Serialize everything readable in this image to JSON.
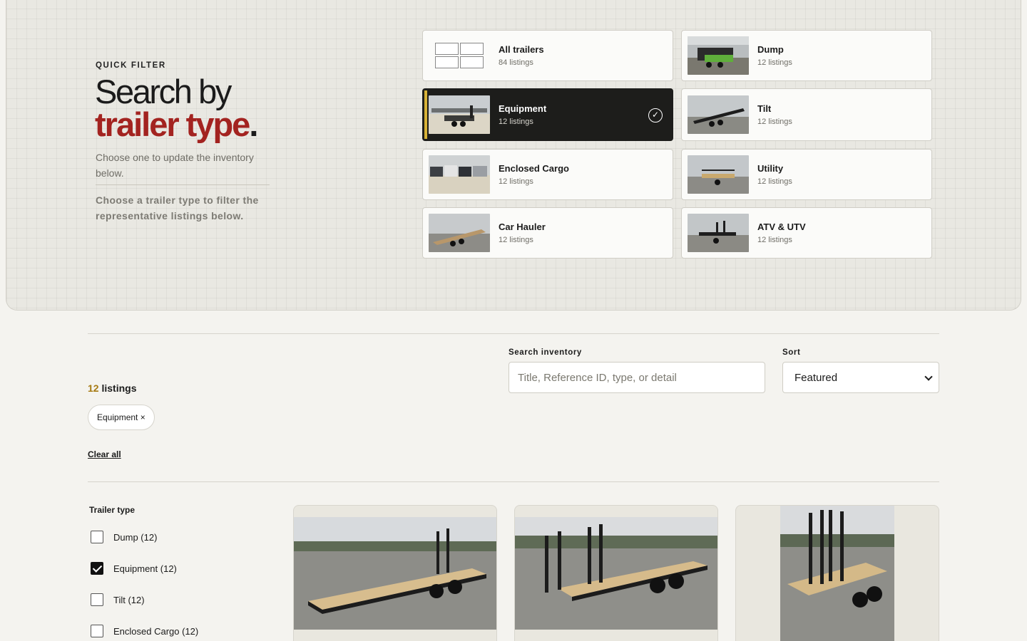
{
  "hero": {
    "eyebrow": "QUICK FILTER",
    "headline_plain": "Search by",
    "headline_accent": "trailer type",
    "headline_dot": ".",
    "description": "Choose one to update the inventory below.",
    "note": "Choose a trailer type to filter the representative listings below."
  },
  "trailer_types": [
    {
      "title": "All trailers",
      "count": "84 listings"
    },
    {
      "title": "Dump",
      "count": "12 listings"
    },
    {
      "title": "Equipment",
      "count": "12 listings",
      "selected": true
    },
    {
      "title": "Tilt",
      "count": "12 listings"
    },
    {
      "title": "Enclosed Cargo",
      "count": "12 listings"
    },
    {
      "title": "Utility",
      "count": "12 listings"
    },
    {
      "title": "Car Hauler",
      "count": "12 listings"
    },
    {
      "title": "ATV & UTV",
      "count": "12 listings"
    }
  ],
  "toolbar": {
    "count_number": "12",
    "count_label": "listings",
    "active_chip": "Equipment ×",
    "clear_all": "Clear all",
    "search_label": "Search inventory",
    "search_placeholder": "Title, Reference ID, type, or detail",
    "sort_label": "Sort",
    "sort_value": "Featured"
  },
  "filters": {
    "heading": "Trailer type",
    "items": [
      {
        "label": "Dump (12)",
        "checked": false
      },
      {
        "label": "Equipment (12)",
        "checked": true
      },
      {
        "label": "Tilt (12)",
        "checked": false
      },
      {
        "label": "Enclosed Cargo (12)",
        "checked": false
      }
    ]
  },
  "colors": {
    "accent_red": "#a32320",
    "accent_gold": "#d8b237",
    "count_gold": "#a67a12",
    "active_card": "#1d1d1b"
  },
  "icons": {
    "selected_check": "check-circle-icon",
    "all_trailers_thumb": "grid-icon",
    "sort_chevron": "chevron-down-icon"
  }
}
